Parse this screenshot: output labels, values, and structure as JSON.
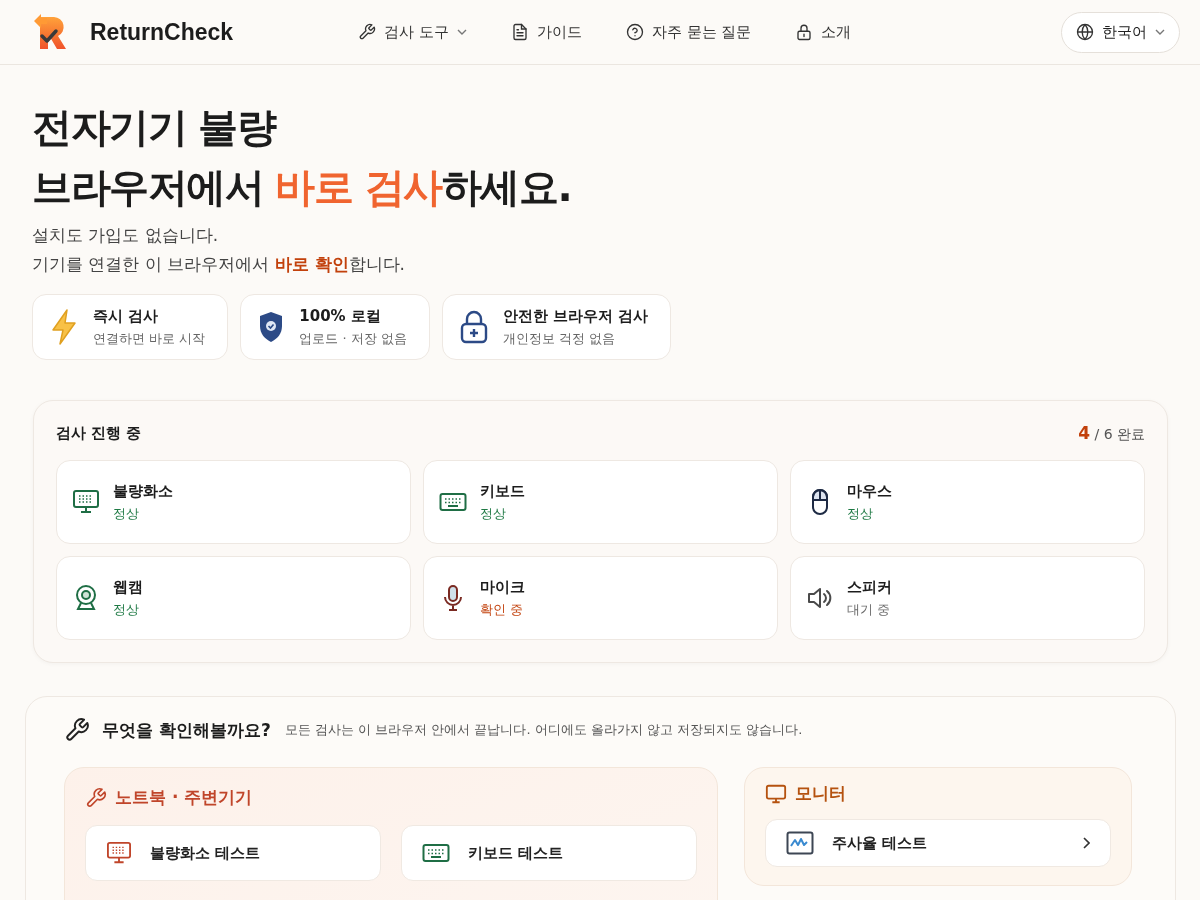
{
  "header": {
    "brand": "ReturnCheck",
    "nav": [
      {
        "label": "검사 도구",
        "dropdown": true
      },
      {
        "label": "가이드",
        "dropdown": false
      },
      {
        "label": "자주 묻는 질문",
        "dropdown": false
      },
      {
        "label": "소개",
        "dropdown": false
      }
    ],
    "language": "한국어"
  },
  "hero": {
    "title_line_1": "전자기기 불량",
    "title_line_2": [
      {
        "text": "브라우저에서 ",
        "highlight": false
      },
      {
        "text": "바로 검사",
        "highlight": true
      },
      {
        "text": "하세요.",
        "highlight": false
      }
    ],
    "subtitle_line_1": [
      {
        "text": "설치도 가입도 없습니다.",
        "highlight": false
      }
    ],
    "subtitle_line_2": [
      {
        "text": "기기를 연결한 이 브라우저에서 ",
        "highlight": false
      },
      {
        "text": "바로 확인",
        "highlight": true
      },
      {
        "text": "합니다.",
        "highlight": false
      }
    ],
    "features": [
      {
        "title": "즉시 검사",
        "subtitle": "연결하면 바로 시작"
      },
      {
        "title": "100% 로컬",
        "subtitle": "업로드 · 저장 없음"
      },
      {
        "title": "안전한 브라우저 검사",
        "subtitle": "개인정보 걱정 없음"
      }
    ]
  },
  "progress": {
    "title": "검사 진행 중",
    "done": "4",
    "total": "/ 6 완료",
    "devices": [
      {
        "name": "불량화소",
        "status": "정상",
        "kind": "ok"
      },
      {
        "name": "키보드",
        "status": "정상",
        "kind": "ok"
      },
      {
        "name": "마우스",
        "status": "정상",
        "kind": "ok"
      },
      {
        "name": "웹캠",
        "status": "정상",
        "kind": "ok"
      },
      {
        "name": "마이크",
        "status": "확인 중",
        "kind": "checking"
      },
      {
        "name": "스피커",
        "status": "대기 중",
        "kind": "waiting"
      }
    ]
  },
  "tools": {
    "title": "무엇을 확인해볼까요?",
    "description": "모든 검사는 이 브라우저 안에서 끝납니다. 어디에도 올라가지 않고 저장되지도 않습니다.",
    "categories": [
      {
        "title": "노트북 · 주변기기",
        "items": [
          "불량화소 테스트",
          "키보드 테스트"
        ]
      },
      {
        "title": "모니터",
        "items": [
          "주사율 테스트"
        ]
      }
    ]
  }
}
